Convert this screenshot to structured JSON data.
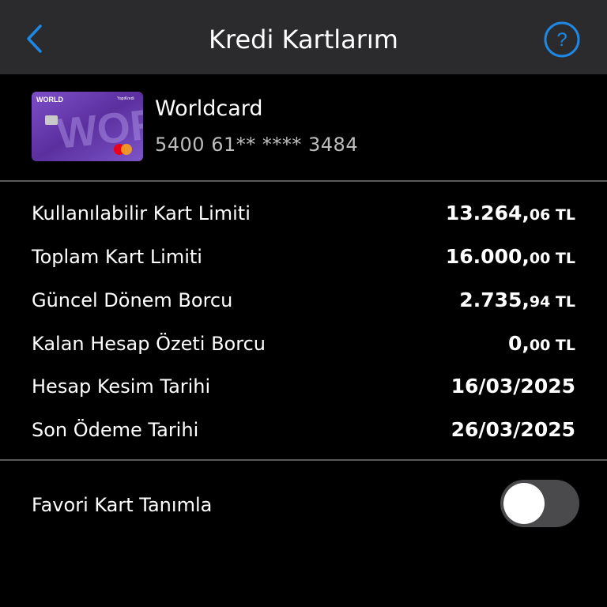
{
  "header": {
    "title": "Kredi Kartlarım",
    "back_icon": "chevron-left-icon",
    "help_icon": "help-circle-icon",
    "accent_color": "#1e88e5"
  },
  "card": {
    "name": "Worldcard",
    "number": "5400 61** **** 3484",
    "image_brand": "WORLD",
    "image_bank": "YapıKredi",
    "image_color": "#6b3fb5"
  },
  "details": [
    {
      "label": "Kullanılabilir Kart Limiti",
      "value_main": "13.264,",
      "value_small": "06 TL"
    },
    {
      "label": "Toplam Kart Limiti",
      "value_main": "16.000,",
      "value_small": "00 TL"
    },
    {
      "label": "Güncel Dönem Borcu",
      "value_main": "2.735,",
      "value_small": "94 TL"
    },
    {
      "label": "Kalan Hesap Özeti Borcu",
      "value_main": "0,",
      "value_small": "00 TL"
    },
    {
      "label": "Hesap Kesim Tarihi",
      "value_main": "16/03/2025",
      "value_small": ""
    },
    {
      "label": "Son Ödeme Tarihi",
      "value_main": "26/03/2025",
      "value_small": ""
    }
  ],
  "favorite": {
    "label": "Favori Kart Tanımla",
    "enabled": false
  }
}
